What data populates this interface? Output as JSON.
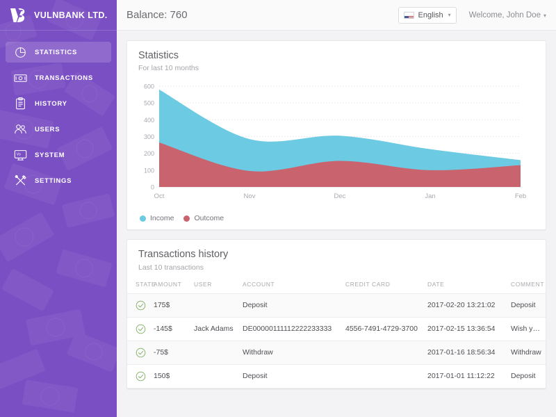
{
  "sidebar": {
    "brand": {
      "logo": "vb-logo",
      "name": "VULNBANK LTD."
    },
    "items": [
      {
        "icon": "pie-chart-icon",
        "label": "STATISTICS",
        "active": true
      },
      {
        "icon": "banknote-icon",
        "label": "TRANSACTIONS",
        "active": false
      },
      {
        "icon": "clipboard-icon",
        "label": "HISTORY",
        "active": false
      },
      {
        "icon": "users-icon",
        "label": "USERS",
        "active": false
      },
      {
        "icon": "monitor-icon",
        "label": "SYSTEM",
        "active": false
      },
      {
        "icon": "tools-icon",
        "label": "SETTINGS",
        "active": false
      }
    ]
  },
  "topbar": {
    "balance_label": "Balance: 760",
    "language": {
      "icon": "us-flag-icon",
      "value": "English",
      "caret": "▾"
    },
    "user_menu": {
      "label": "Welcome, John Doe",
      "caret": "▾"
    }
  },
  "statistics_card": {
    "title": "Statistics",
    "subtitle": "For last 10 months"
  },
  "chart_data": {
    "type": "area",
    "title": "Statistics",
    "subtitle": "For last 10 months",
    "xlabel": "",
    "ylabel": "",
    "ylim": [
      0,
      600
    ],
    "yticks": [
      0,
      100,
      200,
      300,
      400,
      500,
      600
    ],
    "grid": true,
    "legend_position": "bottom-left",
    "categories": [
      "Oct",
      "Nov",
      "Dec",
      "Jan",
      "Feb"
    ],
    "x": [
      0,
      1,
      2,
      3,
      4
    ],
    "stacked": true,
    "series": [
      {
        "name": "Income",
        "color": "#6ccbe3",
        "values": [
          580,
          285,
          305,
          225,
          160
        ]
      },
      {
        "name": "Outcome",
        "color": "#c9636e",
        "values": [
          265,
          95,
          155,
          100,
          130
        ]
      }
    ],
    "legend": [
      {
        "label": "Income",
        "color": "#6ccbe3"
      },
      {
        "label": "Outcome",
        "color": "#c9636e"
      }
    ]
  },
  "transactions_card": {
    "title": "Transactions history",
    "subtitle": "Last 10 transactions",
    "columns": [
      "STATE",
      "AMOUNT",
      "USER",
      "ACCOUNT",
      "CREDIT CARD",
      "DATE",
      "COMMENT"
    ],
    "rows": [
      {
        "state": "ok",
        "amount": "175$",
        "amount_sign": "pos",
        "user": "",
        "account": "Deposit",
        "credit_card": "",
        "date": "2017-02-20 13:21:02",
        "comment": "Deposit"
      },
      {
        "state": "ok",
        "amount": "-145$",
        "amount_sign": "neg",
        "user": "Jack Adams",
        "account": "DE00000111112222233333",
        "credit_card": "4556-7491-4729-3700",
        "date": "2017-02-15 13:36:54",
        "comment": "Wish you all the best"
      },
      {
        "state": "ok",
        "amount": "-75$",
        "amount_sign": "neg",
        "user": "",
        "account": "Withdraw",
        "credit_card": "",
        "date": "2017-01-16 18:56:34",
        "comment": "Withdraw"
      },
      {
        "state": "ok",
        "amount": "150$",
        "amount_sign": "pos",
        "user": "",
        "account": "Deposit",
        "credit_card": "",
        "date": "2017-01-01 11:12:22",
        "comment": "Deposit"
      }
    ]
  },
  "colors": {
    "sidebar": "#7b4fc4",
    "income": "#6ccbe3",
    "outcome": "#c9636e",
    "positive": "#9ec04f",
    "negative": "#d2616c",
    "page_bg": "#f3f3f5"
  }
}
